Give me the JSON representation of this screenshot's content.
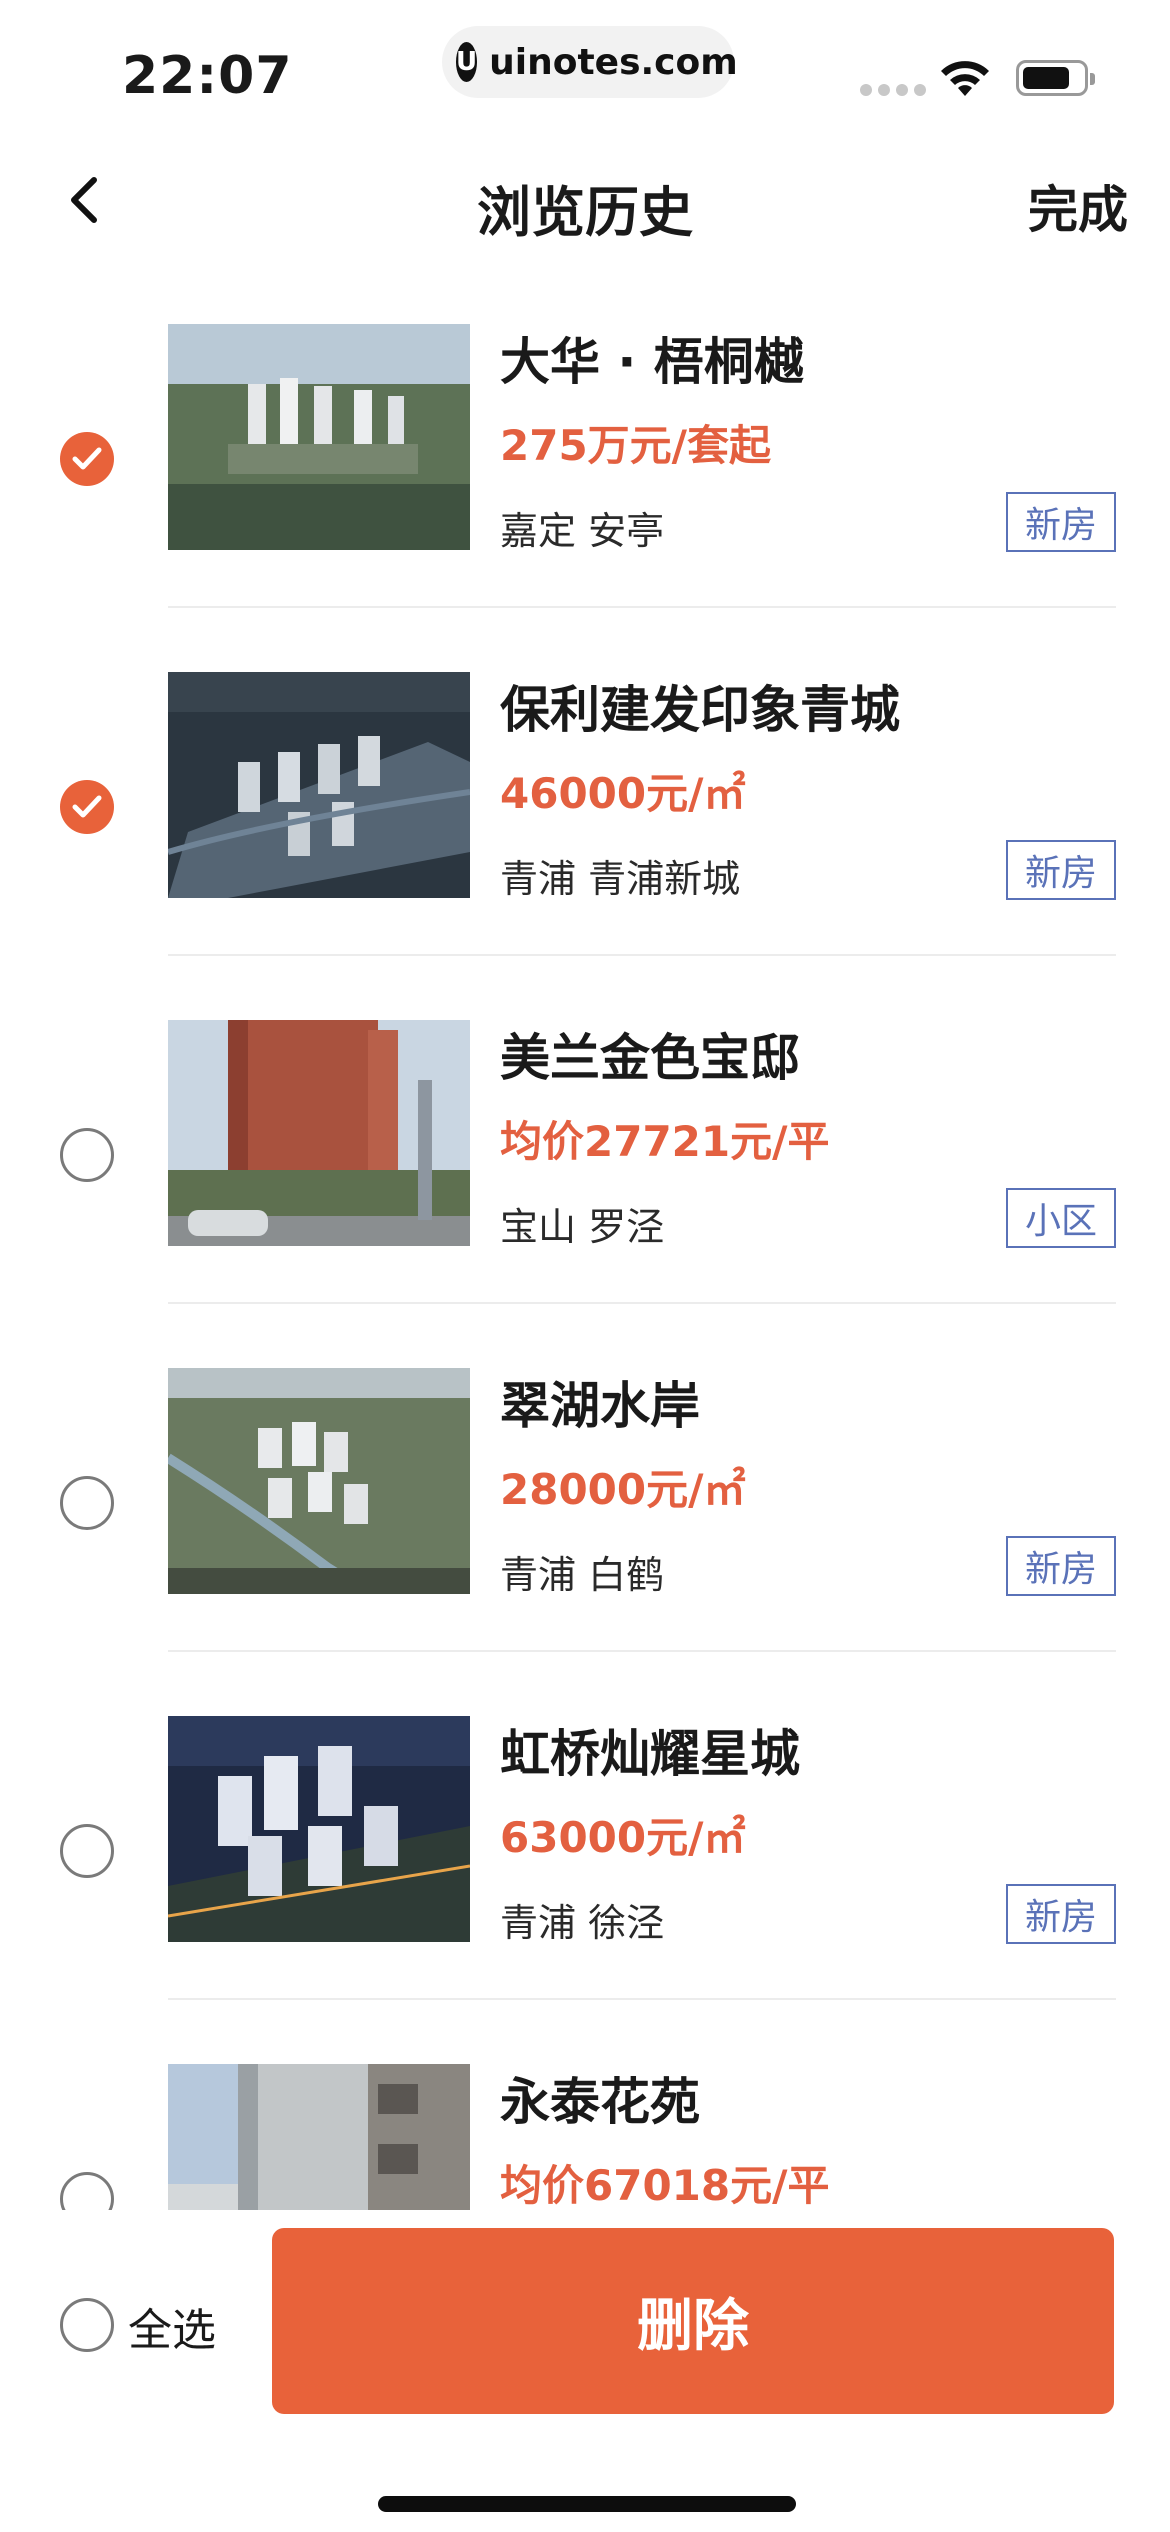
{
  "status_bar": {
    "time": "22:07",
    "url": "uinotes.com",
    "url_logo": "U",
    "icons": [
      "signal-icon",
      "wifi-icon",
      "battery-icon"
    ]
  },
  "nav": {
    "back_icon": "chevron-left-icon",
    "title": "浏览历史",
    "done": "完成"
  },
  "colors": {
    "accent": "#e8623a",
    "price": "#e36040",
    "tag": "#5a72b8",
    "divider": "#ececec"
  },
  "items": [
    {
      "name": "大华 · 梧桐樾",
      "price": "275万元/套起",
      "location": "嘉定 安亭",
      "tag": "新房",
      "checked": true
    },
    {
      "name": "保利建发印象青城",
      "price": "46000元/㎡",
      "location": "青浦 青浦新城",
      "tag": "新房",
      "checked": true
    },
    {
      "name": "美兰金色宝邸",
      "price": "均价27721元/平",
      "location": "宝山 罗泾",
      "tag": "小区",
      "checked": false
    },
    {
      "name": "翠湖水岸",
      "price": "28000元/㎡",
      "location": "青浦 白鹤",
      "tag": "新房",
      "checked": false
    },
    {
      "name": "虹桥灿耀星城",
      "price": "63000元/㎡",
      "location": "青浦 徐泾",
      "tag": "新房",
      "checked": false
    },
    {
      "name": "永泰花苑",
      "price": "均价67018元/平",
      "location": "",
      "tag": "",
      "checked": false
    }
  ],
  "bottom": {
    "select_all": "全选",
    "delete": "删除"
  }
}
